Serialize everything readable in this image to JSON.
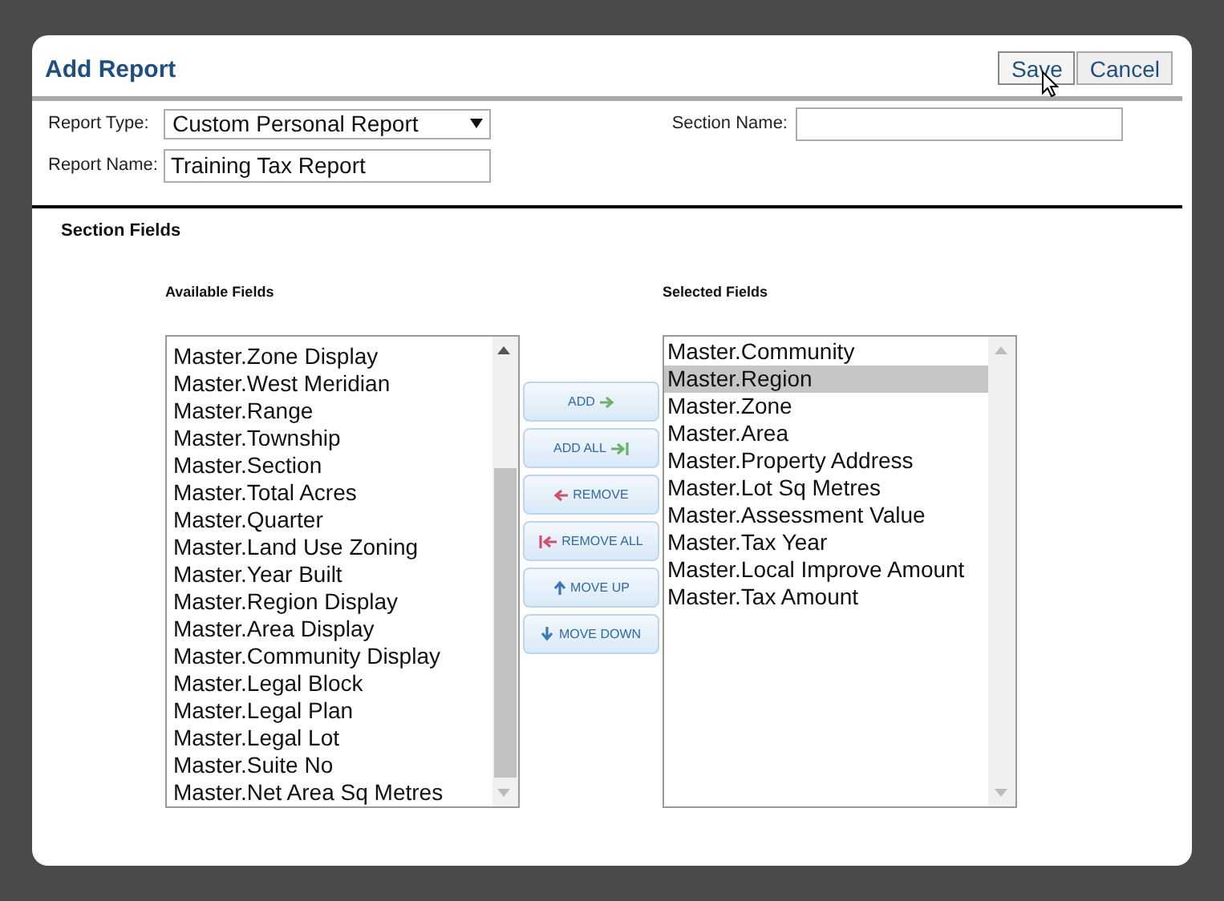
{
  "dialog": {
    "title": "Add Report",
    "buttons": [
      {
        "label": "Save",
        "hovered": true
      },
      {
        "label": "Cancel",
        "hovered": false
      }
    ]
  },
  "form": {
    "report_type": {
      "label": "Report Type:",
      "value": "Custom Personal Report"
    },
    "report_name": {
      "label": "Report Name:",
      "value": "Training Tax Report"
    },
    "section_name": {
      "label": "Section Name:"
    }
  },
  "section_fields": {
    "heading": "Section Fields",
    "available": {
      "label": "Available Fields",
      "items": [
        {
          "text": "Master.Zone Display",
          "selected": false
        },
        {
          "text": "Master.West Meridian",
          "selected": false
        },
        {
          "text": "Master.Range",
          "selected": false
        },
        {
          "text": "Master.Township",
          "selected": false
        },
        {
          "text": "Master.Section",
          "selected": false
        },
        {
          "text": "Master.Total Acres",
          "selected": false
        },
        {
          "text": "Master.Quarter",
          "selected": false
        },
        {
          "text": "Master.Land Use Zoning",
          "selected": false
        },
        {
          "text": "Master.Year Built",
          "selected": false
        },
        {
          "text": "Master.Region Display",
          "selected": false
        },
        {
          "text": "Master.Area Display",
          "selected": false
        },
        {
          "text": "Master.Community Display",
          "selected": false
        },
        {
          "text": "Master.Legal Block",
          "selected": false
        },
        {
          "text": "Master.Legal Plan",
          "selected": false
        },
        {
          "text": "Master.Legal Lot",
          "selected": false
        },
        {
          "text": "Master.Suite No",
          "selected": false
        },
        {
          "text": "Master.Net Area Sq Metres",
          "selected": false
        }
      ]
    },
    "actions": [
      {
        "label": "ADD",
        "kind": "add"
      },
      {
        "label": "ADD ALL",
        "kind": "add_all"
      },
      {
        "label": "REMOVE",
        "kind": "remove"
      },
      {
        "label": "REMOVE ALL",
        "kind": "remove_all"
      },
      {
        "label": "MOVE UP",
        "kind": "up"
      },
      {
        "label": "MOVE DOWN",
        "kind": "down"
      }
    ],
    "selected": {
      "label": "Selected Fields",
      "items": [
        {
          "text": "Master.Community",
          "selected": false
        },
        {
          "text": "Master.Region",
          "selected": true
        },
        {
          "text": "Master.Zone",
          "selected": false
        },
        {
          "text": "Master.Area",
          "selected": false
        },
        {
          "text": "Master.Property Address",
          "selected": false
        },
        {
          "text": "Master.Lot Sq Metres",
          "selected": false
        },
        {
          "text": "Master.Assessment Value",
          "selected": false
        },
        {
          "text": "Master.Tax Year",
          "selected": false
        },
        {
          "text": "Master.Local Improve Amount",
          "selected": false
        },
        {
          "text": "Master.Tax Amount",
          "selected": false
        }
      ]
    }
  }
}
